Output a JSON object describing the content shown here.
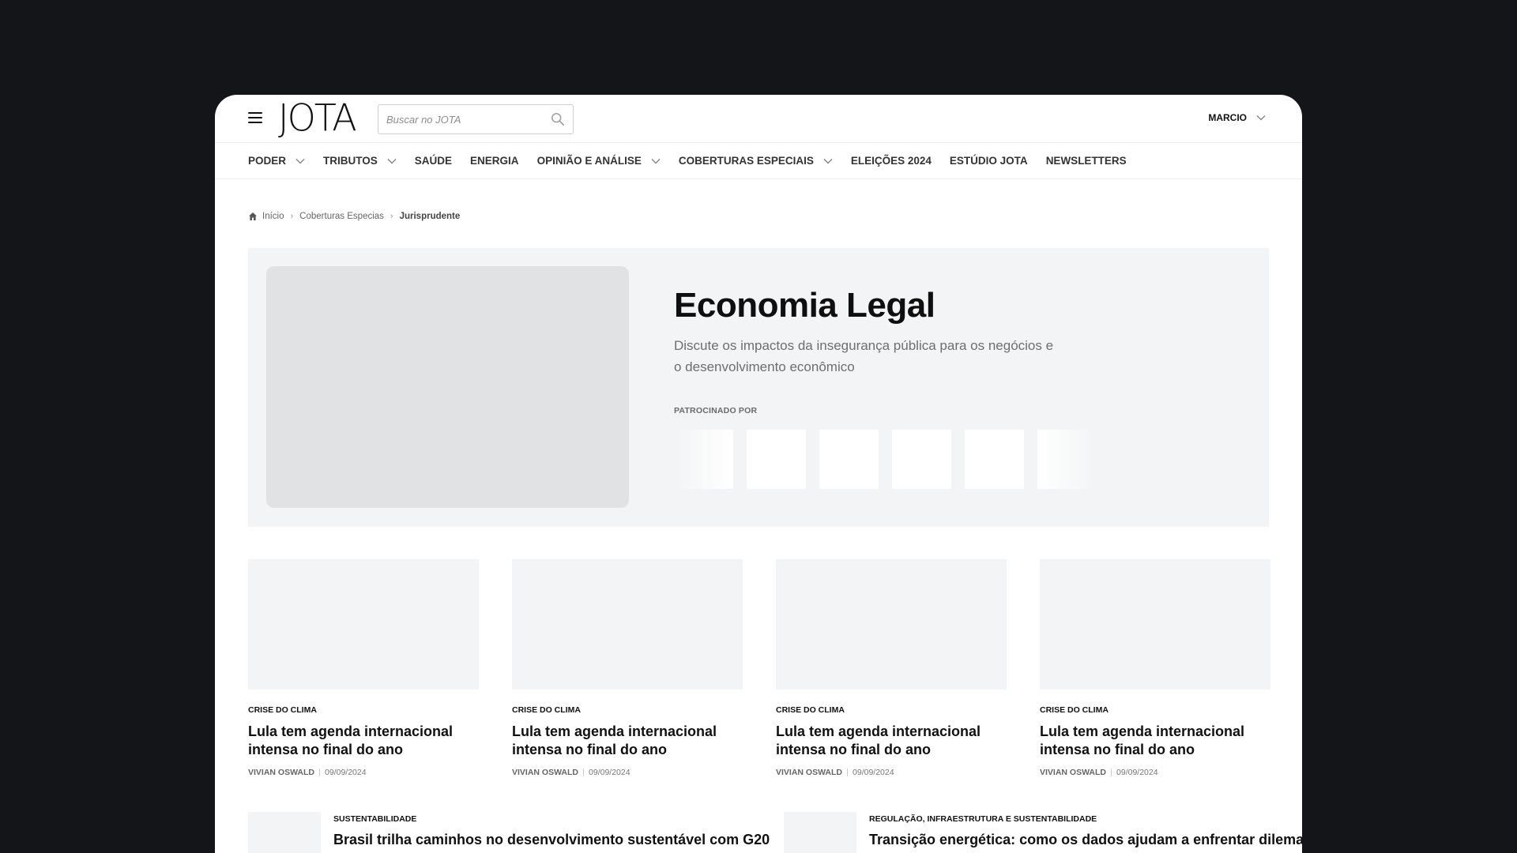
{
  "header": {
    "logo": "JOTA",
    "search_placeholder": "Buscar no JOTA",
    "user_name": "MARCIO"
  },
  "nav": {
    "items": [
      {
        "label": "PODER",
        "dropdown": true
      },
      {
        "label": "TRIBUTOS",
        "dropdown": true
      },
      {
        "label": "SAÚDE",
        "dropdown": false
      },
      {
        "label": "ENERGIA",
        "dropdown": false
      },
      {
        "label": "OPINIÃO E ANÁLISE",
        "dropdown": true
      },
      {
        "label": "COBERTURAS ESPECIAIS",
        "dropdown": true
      },
      {
        "label": "ELEIÇÕES 2024",
        "dropdown": false
      },
      {
        "label": "ESTÚDIO JOTA",
        "dropdown": false
      },
      {
        "label": "NEWSLETTERS",
        "dropdown": false
      }
    ]
  },
  "breadcrumb": {
    "home": "Início",
    "section": "Coberturas Especias",
    "current": "Jurisprudente"
  },
  "hero": {
    "title": "Economia Legal",
    "description": "Discute os impactos da insegurança pública para os negócios e o desenvolvimento econômico",
    "sponsor_label": "PATROCINADO POR"
  },
  "cards": [
    {
      "category": "CRISE DO CLIMA",
      "title": "Lula tem agenda internacional intensa no final do ano",
      "author": "VIVIAN OSWALD",
      "date": "09/09/2024"
    },
    {
      "category": "CRISE DO CLIMA",
      "title": "Lula tem agenda internacional intensa no final do ano",
      "author": "VIVIAN OSWALD",
      "date": "09/09/2024"
    },
    {
      "category": "CRISE DO CLIMA",
      "title": "Lula tem agenda internacional intensa no final do ano",
      "author": "VIVIAN OSWALD",
      "date": "09/09/2024"
    },
    {
      "category": "CRISE DO CLIMA",
      "title": "Lula tem agenda internacional intensa no final do ano",
      "author": "VIVIAN OSWALD",
      "date": "09/09/2024"
    }
  ],
  "rows": [
    {
      "category": "SUSTENTABILIDADE",
      "title": "Brasil trilha caminhos no desenvolvimento sustentável com G20"
    },
    {
      "category": "REGULAÇÃO, INFRAESTRUTURA E SUSTENTABILIDADE",
      "title": "Transição energética: como os dados ajudam a enfrentar dilema"
    }
  ],
  "colors": {
    "page_bg": "#141519",
    "hero_bg": "#f3f4f5",
    "placeholder": "#e1e2e4"
  }
}
